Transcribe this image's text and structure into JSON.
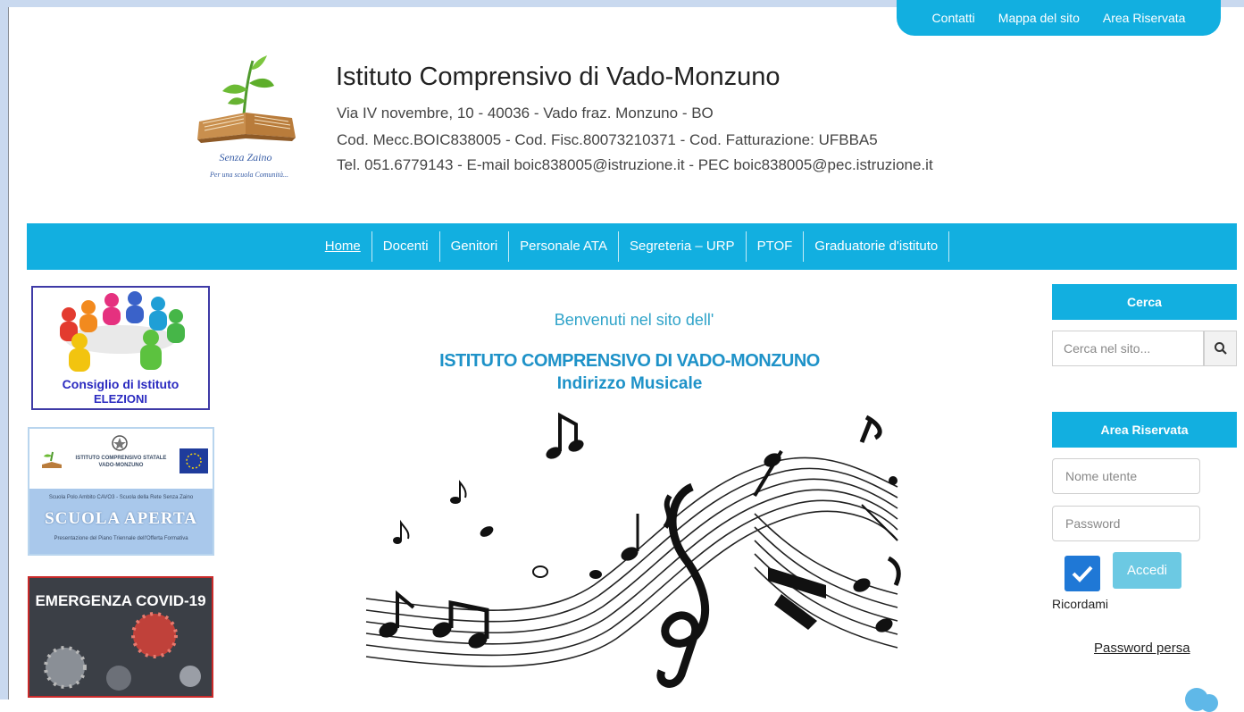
{
  "top_links": [
    "Contatti",
    "Mappa del sito",
    "Area Riservata"
  ],
  "header": {
    "title": "Istituto Comprensivo di Vado-Monzuno",
    "address": "Via IV novembre, 10 - 40036 - Vado fraz. Monzuno - BO",
    "codes": "Cod. Mecc.BOIC838005 - Cod. Fisc.80073210371 - Cod. Fatturazione: UFBBA5",
    "contacts": "Tel. 051.6779143 - E-mail boic838005@istruzione.it - PEC boic838005@pec.istruzione.it",
    "logo_text_1": "Senza Zaino",
    "logo_text_2": "Per una scuola Comunità..."
  },
  "nav": {
    "items": [
      "Home",
      "Docenti",
      "Genitori",
      "Personale ATA",
      "Segreteria – URP",
      "PTOF",
      "Graduatorie d'istituto"
    ],
    "active": "Home"
  },
  "banners": {
    "consiglio": {
      "line1": "Consiglio di Istituto",
      "line2": "ELEZIONI"
    },
    "scuola_aperta": {
      "school_line1": "ISTITUTO COMPRENSIVO STATALE",
      "school_line2": "VADO-MONZUNO",
      "tagline": "Scuola Polo Ambito CAVO3 - Scuola della Rete Senza Zaino",
      "title": "SCUOLA APERTA",
      "subtitle": "Presentazione del Piano Triennale dell'Offerta Formativa"
    },
    "covid": {
      "caption": "EMERGENZA COVID-19"
    }
  },
  "main": {
    "welcome": "Benvenuti nel sito dell'",
    "school": "ISTITUTO COMPRENSIVO DI VADO-MONZUNO",
    "subtitle": "Indirizzo Musicale"
  },
  "sidebar": {
    "search_title": "Cerca",
    "search_placeholder": "Cerca nel sito...",
    "area_title": "Area Riservata",
    "username_placeholder": "Nome utente",
    "password_placeholder": "Password",
    "remember_label": "Ricordami",
    "remember_checked": true,
    "login_label": "Accedi",
    "lost_password": "Password persa"
  },
  "colors": {
    "accent": "#12afe0",
    "frame": "#c9d9ef",
    "heading_blue": "#1e92c8"
  }
}
